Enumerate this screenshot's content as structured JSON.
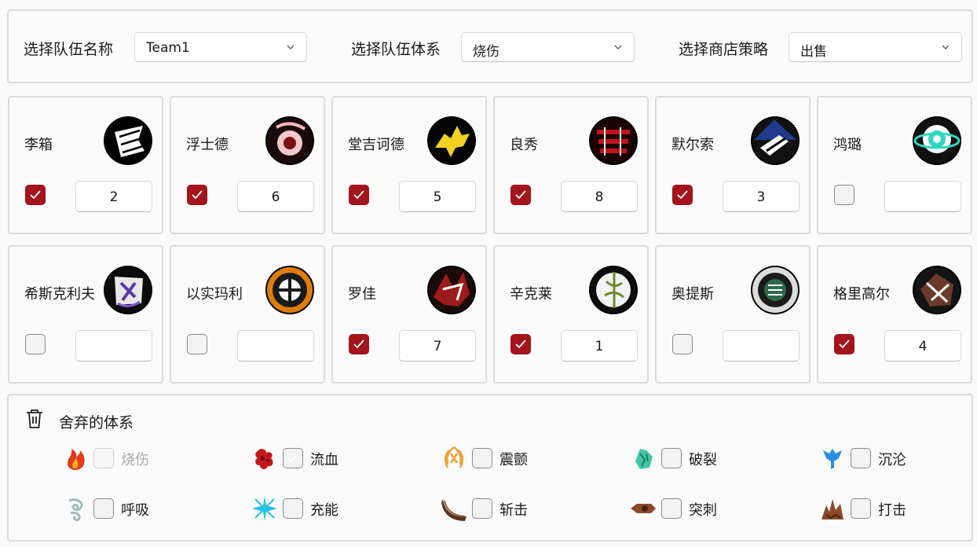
{
  "top": {
    "team_label": "选择队伍名称",
    "team_value": "Team1",
    "system_label": "选择队伍体系",
    "system_value": "烧伤",
    "shop_label": "选择商店策略",
    "shop_value": "出售"
  },
  "characters": [
    {
      "name": "李箱",
      "checked": true,
      "value": "2"
    },
    {
      "name": "浮士德",
      "checked": true,
      "value": "6"
    },
    {
      "name": "堂吉诃德",
      "checked": true,
      "value": "5"
    },
    {
      "name": "良秀",
      "checked": true,
      "value": "8"
    },
    {
      "name": "默尔索",
      "checked": true,
      "value": "3"
    },
    {
      "name": "鸿璐",
      "checked": false,
      "value": ""
    },
    {
      "name": "希斯克利夫",
      "checked": false,
      "value": ""
    },
    {
      "name": "以实玛利",
      "checked": false,
      "value": ""
    },
    {
      "name": "罗佳",
      "checked": true,
      "value": "7"
    },
    {
      "name": "辛克莱",
      "checked": true,
      "value": "1"
    },
    {
      "name": "奥提斯",
      "checked": false,
      "value": ""
    },
    {
      "name": "格里高尔",
      "checked": true,
      "value": "4"
    }
  ],
  "discard": {
    "title": "舍弃的体系",
    "systems": [
      {
        "label": "烧伤",
        "icon": "burn-icon",
        "checked": false,
        "disabled": true
      },
      {
        "label": "流血",
        "icon": "bleed-icon",
        "checked": true,
        "disabled": false
      },
      {
        "label": "震颤",
        "icon": "tremor-icon",
        "checked": false,
        "disabled": false
      },
      {
        "label": "破裂",
        "icon": "rupture-icon",
        "checked": false,
        "disabled": false
      },
      {
        "label": "沉沦",
        "icon": "sinking-icon",
        "checked": false,
        "disabled": false
      },
      {
        "label": "呼吸",
        "icon": "poise-icon",
        "checked": false,
        "disabled": false
      },
      {
        "label": "充能",
        "icon": "charge-icon",
        "checked": false,
        "disabled": false
      },
      {
        "label": "斩击",
        "icon": "slash-icon",
        "checked": false,
        "disabled": false
      },
      {
        "label": "突刺",
        "icon": "pierce-icon",
        "checked": false,
        "disabled": false
      },
      {
        "label": "打击",
        "icon": "blunt-icon",
        "checked": false,
        "disabled": false
      }
    ]
  },
  "colors": {
    "accent": "#a3141c",
    "border": "#dcdcdc"
  }
}
